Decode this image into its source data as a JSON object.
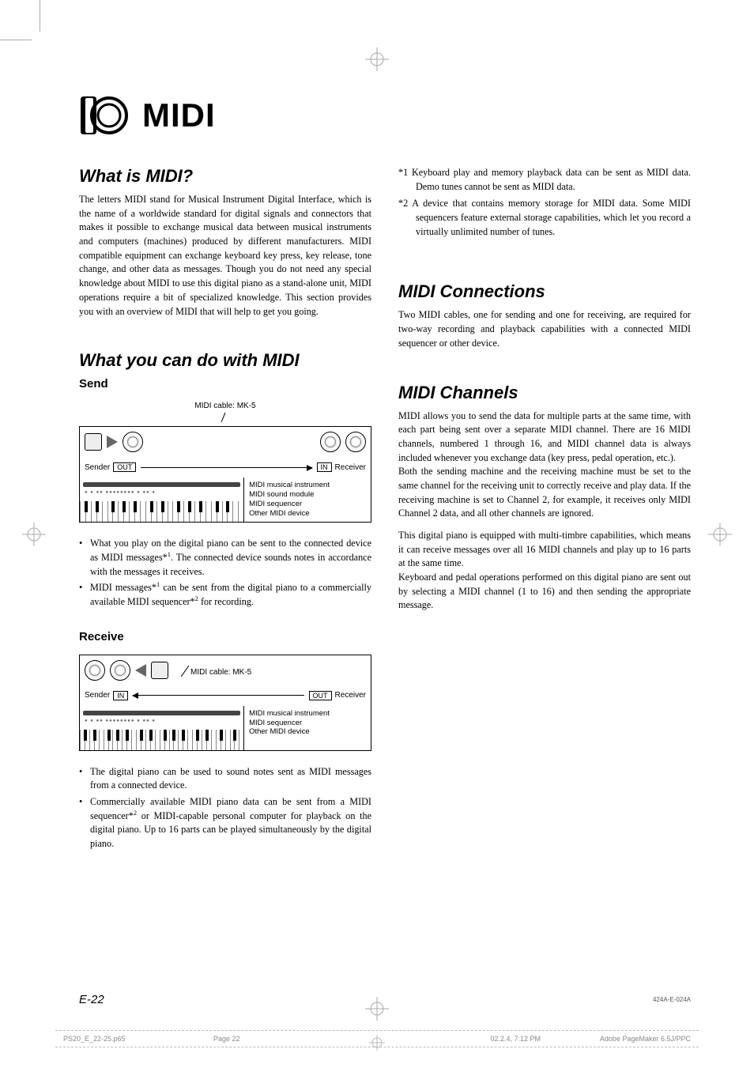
{
  "chapter": {
    "title": "MIDI"
  },
  "left": {
    "s1": {
      "heading": "What is MIDI?",
      "p1": "The letters MIDI stand for Musical Instrument Digital Interface, which is the name of a worldwide standard for digital signals and connectors that makes it possible to exchange musical data between musical instruments and computers (machines) produced by different manufacturers. MIDI compatible equipment can exchange keyboard key press, key release, tone change, and other data as messages. Though you do not need any special knowledge about MIDI to use this digital piano as a stand-alone unit, MIDI operations require a bit of specialized knowledge. This section provides you with an overview of MIDI that will help to get you going."
    },
    "s2": {
      "heading": "What you can do with MIDI",
      "send": "Send",
      "receive": "Receive",
      "diagram": {
        "cable": "MIDI cable: MK-5",
        "sender": "Sender",
        "receiver": "Receiver",
        "out": "OUT",
        "in": "IN",
        "info_send": "MIDI musical instrument\nMIDI sound module\nMIDI sequencer\nOther MIDI device",
        "info_recv": "MIDI musical instrument\nMIDI sequencer\nOther MIDI device"
      },
      "send_b1_a": "What you play on the digital piano can be sent to the connected device as MIDI messages*",
      "send_b1_b": ". The connected device sounds notes in accordance with the messages it receives.",
      "send_b2_a": "MIDI messages*",
      "send_b2_b": " can be sent from the digital piano to a commercially available MIDI sequencer*",
      "send_b2_c": " for recording.",
      "recv_b1": "The digital piano can be used to sound notes sent as MIDI messages from a connected device.",
      "recv_b2_a": "Commercially available MIDI piano data can be sent from a MIDI sequencer*",
      "recv_b2_b": " or MIDI-capable personal computer for playback on the digital piano. Up to 16 parts can be played simultaneously by the digital piano."
    }
  },
  "right": {
    "fn1_a": "*1",
    "fn1_b": "Keyboard play and memory playback data can be sent as MIDI data. Demo tunes cannot be sent as MIDI data.",
    "fn2_a": "*2",
    "fn2_b": "A device that contains memory storage for MIDI data. Some MIDI sequencers feature external storage capabilities, which let you record a virtually unlimited number of tunes.",
    "s3": {
      "heading": "MIDI Connections",
      "p1": "Two MIDI cables, one for sending and one for receiving, are required for two-way recording and playback capabilities with a connected MIDI sequencer or other device."
    },
    "s4": {
      "heading": "MIDI Channels",
      "p1": "MIDI allows you to send the data for multiple parts at the same time, with each part being sent over a separate MIDI channel. There are 16 MIDI channels, numbered 1 through 16, and MIDI channel data is always included whenever you exchange data (key press, pedal operation, etc.).",
      "p2": "Both the sending machine and the receiving machine must be set to the same channel for the receiving unit to correctly receive and play data. If the receiving machine is set to Channel 2, for example, it receives only MIDI Channel 2 data, and all other channels are ignored.",
      "p3": "This digital piano is equipped with multi-timbre capabilities, which means it can receive messages over all 16 MIDI channels and play up to 16 parts at the same time.",
      "p4": "Keyboard and pedal operations performed on this digital piano are sent out by selecting a MIDI channel (1 to 16) and then sending the appropriate message."
    }
  },
  "footer": {
    "page_num": "E-22",
    "doc_code": "424A-E-024A",
    "imposition": {
      "file": "PS20_E_22-25.p65",
      "page": "Page 22",
      "date": "02.2.4, 7:12 PM",
      "app": "Adobe PageMaker 6.5J/PPC"
    }
  }
}
